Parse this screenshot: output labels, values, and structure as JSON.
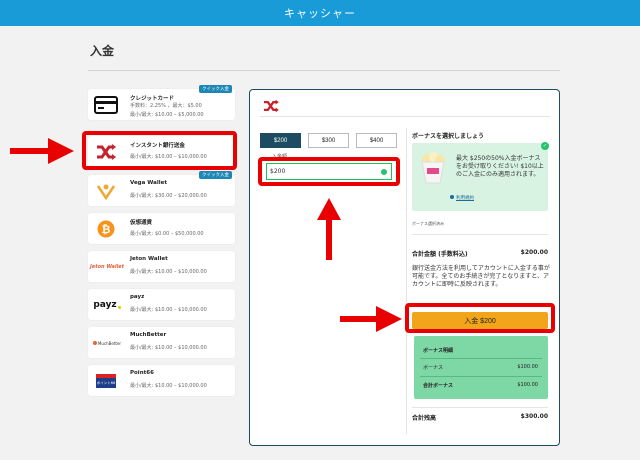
{
  "header": {
    "title": "キャッシャー"
  },
  "page": {
    "title": "入金"
  },
  "quick_badge": "クイック入金",
  "methods": [
    {
      "name": "クレジットカード",
      "fee": "手数料：2.25% ，最大：$5.00",
      "limit": "最小/最大: $10.00 – $5,000.00",
      "icon": "credit-card-icon"
    },
    {
      "name": "インスタント銀行送金",
      "limit": "最小/最大: $10.00 – $10,000.00",
      "icon": "shuffle-icon"
    },
    {
      "name": "Vega Wallet",
      "limit": "最小/最大: $30.00 – $20,000.00",
      "icon": "vega-icon"
    },
    {
      "name": "仮想通貨",
      "limit": "最小/最大: $0.00 – $50,000.00",
      "icon": "bitcoin-icon"
    },
    {
      "name": "Jeton Wallet",
      "limit": "最小/最大: $10.00 – $10,000.00",
      "icon": "jeton-icon",
      "logo": "Jeton Wallet"
    },
    {
      "name": "payz",
      "limit": "最小/最大: $10.00 – $10,000.00",
      "icon": "payz-icon",
      "logo": "payz"
    },
    {
      "name": "MuchBetter",
      "limit": "最小/最大: $10.00 – $10,000.00",
      "icon": "muchbetter-icon",
      "logo": "MuchBetter"
    },
    {
      "name": "Point66",
      "limit": "最小/最大: $10.00 – $10,000.00",
      "icon": "point66-icon",
      "logo": "ポイント66"
    }
  ],
  "amounts": [
    "$200",
    "$300",
    "$400"
  ],
  "amount_input": {
    "label": "入金額",
    "value": "$200"
  },
  "bonus": {
    "title": "ボーナスを選択しましょう",
    "text": "最大 $250の50%入金ボーナスをお受け取りください! $10以上のご入金にのみ適用されます。",
    "link": "利用規約",
    "note": "ボーナス選択済み"
  },
  "total": {
    "label": "合計金額 (手数料込)",
    "value": "$200.00"
  },
  "description": "銀行送金方法を利用してアカウントに入金する事が可能です。全てのお手続きが完了となりますと、アカウントに即時に反映されます。",
  "deposit_button": "入金 $200",
  "summary": {
    "title": "ボーナス明細",
    "bonus_label": "ボーナス",
    "bonus_value": "$100.00",
    "total_bonus_label": "合計ボーナス",
    "total_bonus_value": "$100.00"
  },
  "balance": {
    "label": "合計残高",
    "value": "$300.00"
  },
  "colors": {
    "header": "#199bd8",
    "panel_border": "#1c4b62",
    "highlight": "#e90000",
    "button": "#f2a51a",
    "summary": "#7ed8a6"
  }
}
